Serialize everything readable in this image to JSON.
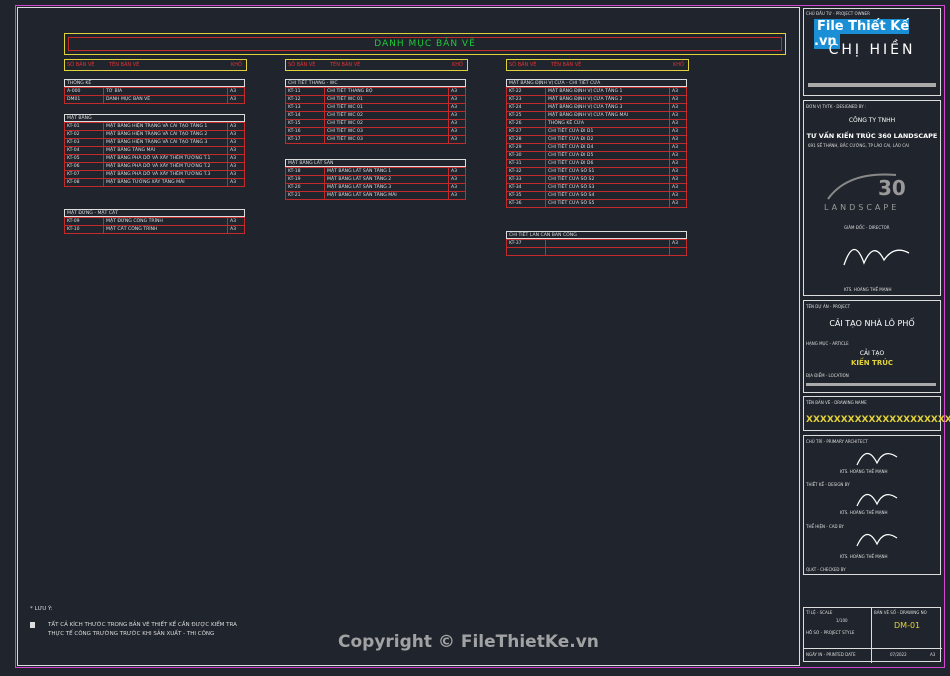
{
  "title": "DANH MỤC BẢN VẼ",
  "columns": {
    "code": "SỐ BẢN VẼ",
    "name": "TÊN BẢN VẼ",
    "size": "KHỔ"
  },
  "col1": [
    {
      "heading": "THÔNG KÊ",
      "rows": [
        [
          "A-000",
          "TỜ BÌA",
          "A3"
        ],
        [
          "DM01",
          "DANH MỤC BẢN VẼ",
          "A3"
        ]
      ]
    },
    {
      "heading": "MẶT BẰNG",
      "rows": [
        [
          "KT-01",
          "MẶT BẰNG HIỆN TRẠNG VÀ CẢI TẠO TẦNG 1",
          "A3"
        ],
        [
          "KT-02",
          "MẶT BẰNG HIỆN TRẠNG VÀ CẢI TẠO TẦNG 2",
          "A3"
        ],
        [
          "KT-03",
          "MẶT BẰNG HIỆN TRẠNG VÀ CẢI TẠO TẦNG 3",
          "A3"
        ],
        [
          "KT-04",
          "MẶT BẰNG TẦNG MÁI",
          "A3"
        ],
        [
          "KT-05",
          "MẶT BẰNG PHÁ DỠ VÀ XÂY THÊM TƯỜNG T.1",
          "A3"
        ],
        [
          "KT-06",
          "MẶT BẰNG PHÁ DỠ VÀ XÂY THÊM TƯỜNG T.2",
          "A3"
        ],
        [
          "KT-07",
          "MẶT BẰNG PHÁ DỠ VÀ XÂY THÊM TƯỜNG T.3",
          "A3"
        ],
        [
          "KT-08",
          "MẶT BẰNG TƯỜNG XÂY TẦNG MÁI",
          "A3"
        ]
      ]
    },
    {
      "heading": "MẶT ĐỨNG - MẶT CẮT",
      "rows": [
        [
          "KT-09",
          "MẶT ĐỨNG CÔNG TRÌNH",
          "A3"
        ],
        [
          "KT-10",
          "MẶT CẮT CÔNG TRÌNH",
          "A3"
        ]
      ]
    }
  ],
  "col2": [
    {
      "heading": "CHI TIẾT THANG - WC",
      "rows": [
        [
          "KT-11",
          "CHI TIẾT THANG BỘ",
          "A3"
        ],
        [
          "KT-12",
          "CHI TIẾT WC 01",
          "A3"
        ],
        [
          "KT-13",
          "CHI TIẾT WC 01",
          "A3"
        ],
        [
          "KT-14",
          "CHI TIẾT WC 02",
          "A3"
        ],
        [
          "KT-15",
          "CHI TIẾT WC 02",
          "A3"
        ],
        [
          "KT-16",
          "CHI TIẾT WC 03",
          "A3"
        ],
        [
          "KT-17",
          "CHI TIẾT WC 03",
          "A3"
        ]
      ]
    },
    {
      "heading": "MẶT BẰNG LÁT SÀN",
      "rows": [
        [
          "KT-18",
          "MẶT BẰNG LÁT SÀN TẦNG 1",
          "A3"
        ],
        [
          "KT-19",
          "MẶT BẰNG LÁT SÀN TẦNG 2",
          "A3"
        ],
        [
          "KT-20",
          "MẶT BẰNG LÁT SÀN TẦNG 3",
          "A3"
        ],
        [
          "KT-21",
          "MẶT BẰNG LÁT SÀN TẦNG MÁI",
          "A3"
        ]
      ]
    }
  ],
  "col3": [
    {
      "heading": "MẶT BẰNG ĐỊNH VỊ CỬA - CHI TIẾT CỬA",
      "rows": [
        [
          "KT-22",
          "MẶT BẰNG ĐỊNH VỊ CỬA TẦNG 1",
          "A3"
        ],
        [
          "KT-23",
          "MẶT BẰNG ĐỊNH VỊ CỬA TẦNG 2",
          "A3"
        ],
        [
          "KT-24",
          "MẶT BẰNG ĐỊNH VỊ CỬA TẦNG 3",
          "A3"
        ],
        [
          "KT-25",
          "MẶT BẰNG ĐỊNH VỊ CỬA TẦNG MÁI",
          "A3"
        ],
        [
          "KT-26",
          "THỐNG KÊ CỬA",
          "A3"
        ],
        [
          "KT-27",
          "CHI TIẾT CỬA ĐI D1",
          "A3"
        ],
        [
          "KT-28",
          "CHI TIẾT CỬA ĐI D2",
          "A3"
        ],
        [
          "KT-29",
          "CHI TIẾT CỬA ĐI D4",
          "A3"
        ],
        [
          "KT-30",
          "CHI TIẾT CỬA ĐI D5",
          "A3"
        ],
        [
          "KT-31",
          "CHI TIẾT CỬA ĐI D6",
          "A3"
        ],
        [
          "KT-32",
          "CHI TIẾT CỬA SỔ S1",
          "A3"
        ],
        [
          "KT-33",
          "CHI TIẾT CỬA SỔ S2",
          "A3"
        ],
        [
          "KT-34",
          "CHI TIẾT CỬA SỔ S3",
          "A3"
        ],
        [
          "KT-35",
          "CHI TIẾT CỬA SỔ S4",
          "A3"
        ],
        [
          "KT-36",
          "CHI TIẾT CỬA SỔ S5",
          "A3"
        ]
      ]
    },
    {
      "heading": "CHI TIẾT LAN CAN BAN CÔNG",
      "rows": [
        [
          "KT-37",
          "",
          "A3"
        ],
        [
          "",
          "",
          ""
        ]
      ]
    }
  ],
  "notes": {
    "title": "* LƯU Ý:",
    "line1": "TẤT CẢ KÍCH THƯỚC TRONG BẢN VẼ THIẾT KẾ CẦN ĐƯỢC KIỂM TRA",
    "line2": "THỰC TẾ CÔNG TRƯỜNG TRƯỚC KHI SẢN XUẤT - THI CÔNG"
  },
  "titleblock": {
    "owner_label": "CHỦ ĐẦU TƯ - PROJECT OWNER",
    "owner": "CHỊ HIỀN",
    "logo": "File Thiết Kế .vn",
    "designer_label": "ĐƠN VỊ TVTK - DESIGNED BY :",
    "company1": "CÔNG TY TNHH",
    "company2": "TƯ VẤN KIẾN TRÚC 360 LANDSCAPE",
    "address": "691 SẾ THÁNH, BẮC CƯỜNG, TP LÀO CAI, LÀO CAI",
    "brand": "LANDSCAPE",
    "director_label": "GIÁM ĐỐC - DIRECTOR",
    "director_name": "KTS. HOÀNG THẾ MẠNH",
    "project_label": "TÊN DỰ ÁN - PROJECT",
    "project": "CẢI TẠO NHÀ LÔ PHỐ",
    "item_label": "HẠNG MỤC - ARTICLE",
    "item1": "CẢI TẠO",
    "item2": "KIẾN TRÚC",
    "location_label": "ĐỊA ĐIỂM - LOCATION",
    "drawing_label": "TÊN BẢN VẼ - DRAWING NAME",
    "drawing_name": "XXXXXXXXXXXXXXXXXXXXX",
    "architect_label": "CHỦ TRÌ - PRIMARY ARCHITECT",
    "design_label": "THIẾT KẾ - DESIGN BY",
    "drawn_label": "THỂ HIỆN - CAD BY",
    "check_label": "QLKT - CHECKED BY",
    "name": "KTS. HOÀNG THẾ MẠNH",
    "scale_label": "TỈ LỆ - SCALE",
    "scale": "1/100",
    "drawing_no_label": "BẢN VẼ SỐ - DRAWING NO",
    "drawing_no": "DM-01",
    "style_label": "HỒ SƠ - PROJECT STYLE",
    "date_label": "NGÀY IN - PRINTED DATE",
    "date": "07/2022",
    "sheet": "A3"
  },
  "watermark": "Copyright © FileThietKe.vn"
}
